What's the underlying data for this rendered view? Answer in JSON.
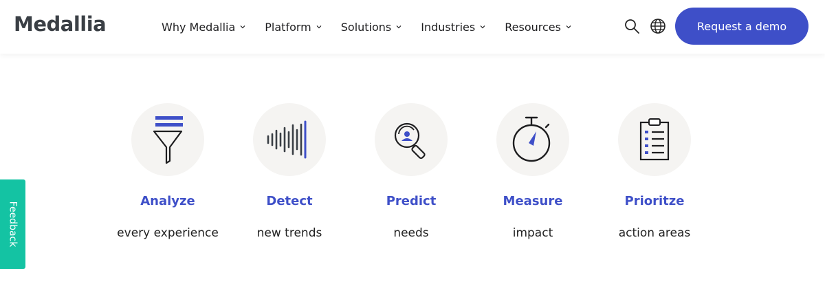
{
  "header": {
    "logo": "Medallia",
    "nav": [
      {
        "label": "Why Medallia"
      },
      {
        "label": "Platform"
      },
      {
        "label": "Solutions"
      },
      {
        "label": "Industries"
      },
      {
        "label": "Resources"
      }
    ],
    "search_icon": "search-icon",
    "globe_icon": "globe-icon",
    "cta_label": "Request a demo"
  },
  "features": [
    {
      "title": "Analyze",
      "subtitle": "every experience",
      "icon": "funnel-icon"
    },
    {
      "title": "Detect",
      "subtitle": "new trends",
      "icon": "soundwave-icon"
    },
    {
      "title": "Predict",
      "subtitle": "needs",
      "icon": "magnifier-person-icon"
    },
    {
      "title": "Measure",
      "subtitle": "impact",
      "icon": "stopwatch-icon"
    },
    {
      "title": "Prioritze",
      "subtitle": "action areas",
      "icon": "clipboard-list-icon"
    }
  ],
  "feedback_label": "Feedback",
  "colors": {
    "accent": "#3e4fc8",
    "feedback": "#14c3a3",
    "icon_bg": "#f5f4f2"
  }
}
